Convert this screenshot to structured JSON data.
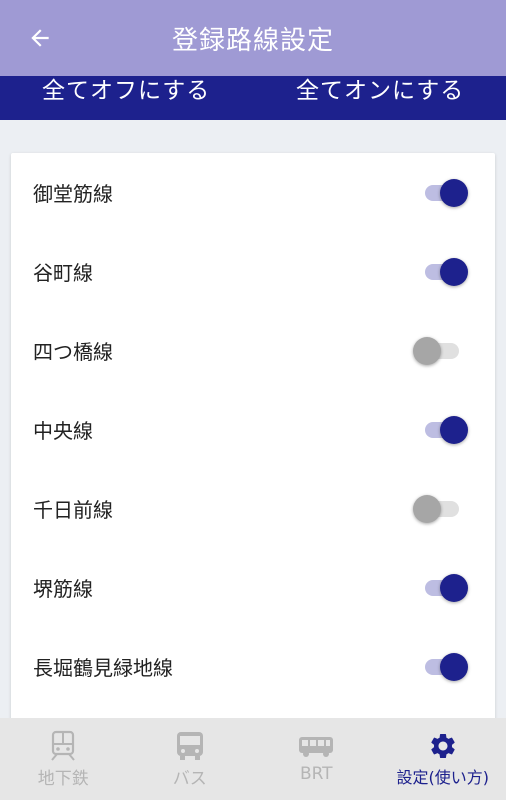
{
  "header": {
    "title": "登録路線設定",
    "back_icon": "arrow-left-icon"
  },
  "actions": {
    "all_off": "全てオフにする",
    "all_on": "全てオンにする"
  },
  "lines": [
    {
      "label": "御堂筋線",
      "enabled": true
    },
    {
      "label": "谷町線",
      "enabled": true
    },
    {
      "label": "四つ橋線",
      "enabled": false
    },
    {
      "label": "中央線",
      "enabled": true
    },
    {
      "label": "千日前線",
      "enabled": false
    },
    {
      "label": "堺筋線",
      "enabled": true
    },
    {
      "label": "長堀鶴見緑地線",
      "enabled": true
    }
  ],
  "bottom_nav": [
    {
      "label": "地下鉄",
      "icon": "train-icon",
      "active": false
    },
    {
      "label": "バス",
      "icon": "bus-icon",
      "active": false
    },
    {
      "label": "BRT",
      "icon": "brt-bus-icon",
      "active": false
    },
    {
      "label": "設定(使い方)",
      "icon": "gear-icon",
      "active": true
    }
  ],
  "colors": {
    "appbar": "#9f9ad4",
    "accent": "#1d218d",
    "switch_track_on": "#bdbde2",
    "switch_off": "#a6a6a6",
    "nav_inactive": "#b5b5b5"
  }
}
